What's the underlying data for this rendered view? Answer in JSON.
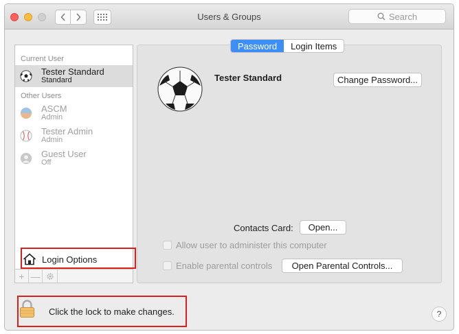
{
  "window": {
    "title": "Users & Groups",
    "search_placeholder": "Search"
  },
  "sidebar": {
    "current_user_header": "Current User",
    "other_users_header": "Other Users",
    "current_user": {
      "name": "Tester Standard",
      "role": "Standard",
      "avatar": "soccer-ball"
    },
    "other_users": [
      {
        "name": "ASCM",
        "role": "Admin",
        "avatar": "beach-photo"
      },
      {
        "name": "Tester Admin",
        "role": "Admin",
        "avatar": "baseball"
      },
      {
        "name": "Guest User",
        "role": "Off",
        "avatar": "generic-person"
      }
    ],
    "login_options": "Login Options",
    "add_symbol": "+",
    "remove_symbol": "—"
  },
  "main": {
    "tabs": [
      {
        "label": "Password",
        "active": true
      },
      {
        "label": "Login Items",
        "active": false
      }
    ],
    "user_name": "Tester Standard",
    "change_password": "Change Password...",
    "contacts_card_label": "Contacts Card:",
    "open_button": "Open...",
    "allow_admin_label": "Allow user to administer this computer",
    "parental_controls_label": "Enable parental controls",
    "open_parental_controls": "Open Parental Controls..."
  },
  "footer": {
    "lock_text": "Click the lock to make changes.",
    "help_symbol": "?"
  },
  "colors": {
    "accent": "#3d8ff7",
    "highlight_border": "#d9201b",
    "selection": "#dcdcdc"
  }
}
